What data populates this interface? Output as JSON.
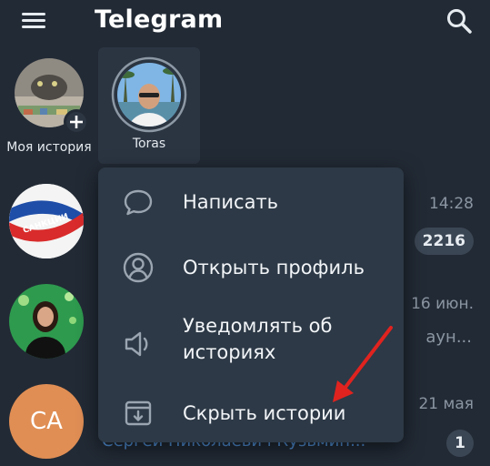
{
  "appbar": {
    "title": "Telegram"
  },
  "stories": [
    {
      "label": "Моя история"
    },
    {
      "label": "Toras"
    }
  ],
  "chats": [
    {
      "time": "14:28",
      "badge": "2216",
      "avatar_colors": [
        "#d92b2b",
        "#1f4ea8",
        "#ffffff"
      ],
      "avatar_text": "САНКЦИИ"
    },
    {
      "time": "16 июн.",
      "preview": "аун..."
    },
    {
      "time": "21 мая",
      "badge": "1",
      "initials": "CA",
      "avatar_color": "#e08e54",
      "preview": "Сергей Николаевич Кузьмин..."
    }
  ],
  "context_menu": {
    "items": [
      {
        "label": "Написать",
        "icon": "chat-bubble-icon"
      },
      {
        "label": "Открыть профиль",
        "icon": "profile-icon"
      },
      {
        "label": "Уведомлять об историях",
        "icon": "speaker-icon"
      },
      {
        "label": "Скрыть истории",
        "icon": "archive-icon"
      }
    ]
  },
  "colors": {
    "background": "#222a35",
    "menu_background": "#2d3946",
    "accent_arrow": "#e0231f",
    "muted_text": "#8b96a3"
  }
}
